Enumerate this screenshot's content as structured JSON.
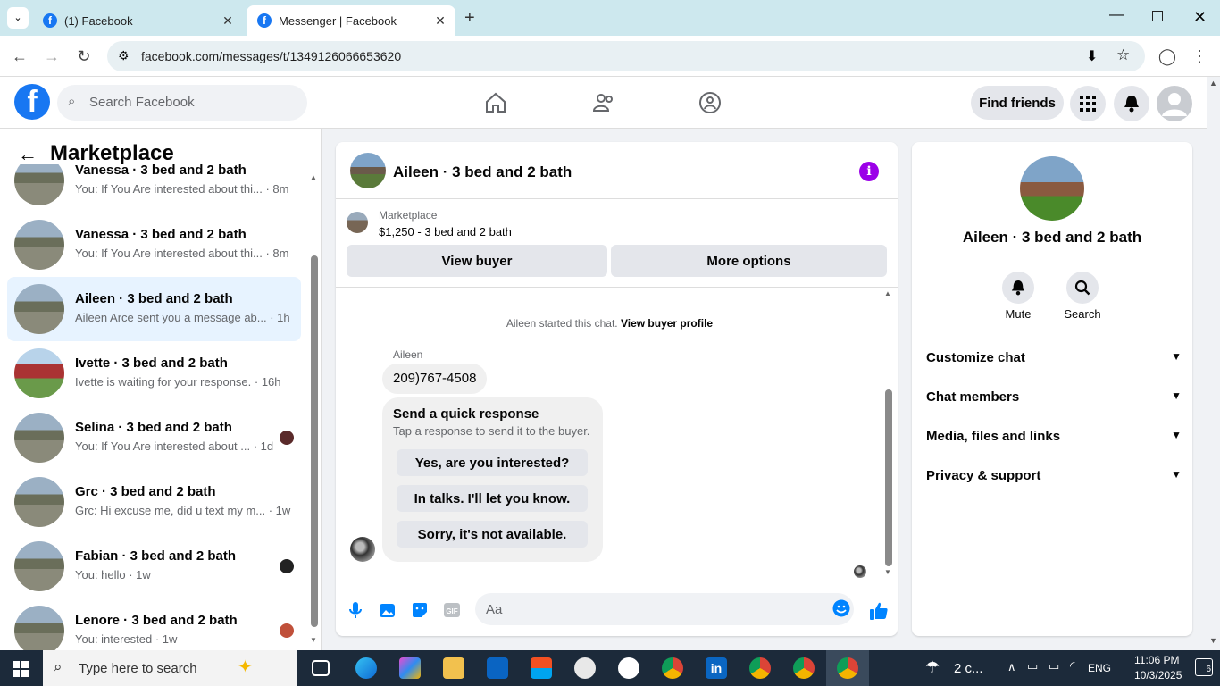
{
  "browser": {
    "tabs": [
      {
        "title": "(1) Facebook",
        "active": false
      },
      {
        "title": "Messenger | Facebook",
        "active": true
      }
    ],
    "url": "facebook.com/messages/t/1349126066653620"
  },
  "header": {
    "search_placeholder": "Search Facebook",
    "find_friends": "Find friends"
  },
  "sidebar": {
    "title": "Marketplace",
    "conversations": [
      {
        "name": "Vanessa · 3 bed and 2 bath",
        "snippet": "You: If You Are interested about thi... · 8m"
      },
      {
        "name": "Vanessa · 3 bed and 2 bath",
        "snippet": "You: If You Are interested about thi... · 8m"
      },
      {
        "name": "Aileen · 3 bed and 2 bath",
        "snippet": "Aileen Arce sent you a message ab... · 1h"
      },
      {
        "name": "Ivette · 3 bed and 2 bath",
        "snippet": "Ivette is waiting for your response. · 16h"
      },
      {
        "name": "Selina · 3 bed and 2 bath",
        "snippet": "You: If You Are interested about ... · 1d"
      },
      {
        "name": "Grc · 3 bed and 2 bath",
        "snippet": "Grc: Hi excuse me, did u text my m... · 1w"
      },
      {
        "name": "Fabian · 3 bed and 2 bath",
        "snippet": "You: hello · 1w"
      },
      {
        "name": "Lenore · 3 bed and 2 bath",
        "snippet": "You: interested · 1w"
      }
    ]
  },
  "chat": {
    "title": "Aileen · 3 bed and 2 bath",
    "marketplace_label": "Marketplace",
    "listing": "$1,250 - 3 bed and 2 bath",
    "view_buyer": "View buyer",
    "more_options": "More options",
    "started_text": "Aileen started this chat.",
    "view_buyer_profile": "View buyer profile",
    "sender": "Aileen",
    "message": "209)767-4508",
    "quick_title": "Send a quick response",
    "quick_sub": "Tap a response to send it to the buyer.",
    "quick_responses": [
      "Yes, are you interested?",
      "In talks. I'll let you know.",
      "Sorry, it's not available."
    ],
    "input_placeholder": "Aa"
  },
  "details": {
    "name": "Aileen · 3 bed and 2 bath",
    "actions": [
      "Mute",
      "Search"
    ],
    "sections": [
      "Customize chat",
      "Chat members",
      "Media, files and links",
      "Privacy & support"
    ]
  },
  "taskbar": {
    "search_placeholder": "Type here to search",
    "weather": "2 c...",
    "language": "ENG",
    "time": "11:06 PM",
    "date": "10/3/2025",
    "notifications": "6"
  }
}
